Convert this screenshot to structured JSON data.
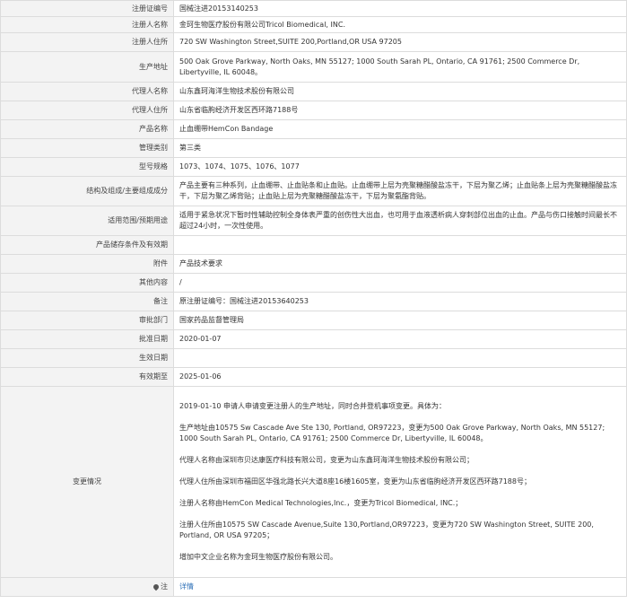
{
  "rows": [
    {
      "label": "注册证编号",
      "value": "国械注进20153140253"
    },
    {
      "label": "注册人名称",
      "value": "金珂生物医疗股份有限公司Tricol Biomedical, INC."
    },
    {
      "label": "注册人住所",
      "value": "720 SW Washington Street,SUITE 200,Portland,OR USA 97205"
    },
    {
      "label": "生产地址",
      "value": "500 Oak Grove Parkway, North Oaks, MN 55127; 1000 South Sarah PL, Ontario, CA 91761; 2500 Commerce Dr, Libertyville, IL 60048。"
    },
    {
      "label": "代理人名称",
      "value": "山东鑫珂海洋生物技术股份有限公司"
    },
    {
      "label": "代理人住所",
      "value": "山东省临朐经济开发区西环路7188号"
    },
    {
      "label": "产品名称",
      "value": "止血绷带HemCon Bandage"
    },
    {
      "label": "管理类别",
      "value": "第三类"
    },
    {
      "label": "型号规格",
      "value": "1073、1074、1075、1076、1077"
    },
    {
      "label": "结构及组成/主要组成成分",
      "value": "产品主要有三种系列，止血绷带、止血贴条和止血贴。止血绷带上层为壳聚糖醋酸盐冻干，下层为聚乙烯；止血贴条上层为壳聚糖醋酸盐冻干，下层为聚乙烯背贴；止血贴上层为壳聚糖醋酸盐冻干，下层为聚氨酯背贴。"
    },
    {
      "label": "适用范围/预期用途",
      "value": "适用于紧急状况下暂时性辅助控制全身体表严重的创伤性大出血，也可用于血液透析病人穿刺部位出血的止血。产品与伤口接触时间最长不超过24小时，一次性使用。"
    },
    {
      "label": "产品储存条件及有效期",
      "value": ""
    },
    {
      "label": "附件",
      "value": "产品技术要求"
    },
    {
      "label": "其他内容",
      "value": "/"
    },
    {
      "label": "备注",
      "value": "原注册证编号：国械注进20153640253"
    },
    {
      "label": "审批部门",
      "value": "国家药品监督管理局"
    },
    {
      "label": "批准日期",
      "value": "2020-01-07"
    },
    {
      "label": "生效日期",
      "value": ""
    },
    {
      "label": "有效期至",
      "value": "2025-01-06"
    }
  ],
  "changes": {
    "label": "变更情况",
    "paragraphs": [
      "2019-01-10 申请人申请变更注册人的生产地址，同时合并登机事项变更。具体为：",
      "生产地址由10575 Sw Cascade Ave Ste 130, Portland, OR97223，变更为500 Oak Grove Parkway, North Oaks, MN 55127; 1000 South Sarah PL, Ontario, CA 91761; 2500 Commerce Dr, Libertyville, IL 60048。",
      "代理人名称由深圳市贝达康医疗科技有限公司，变更为山东鑫珂海洋生物技术股份有限公司；",
      "代理人住所由深圳市福田区华强北路长兴大道8座16楼1605室，变更为山东省临朐经济开发区西环路7188号；",
      "注册人名称由HemCon Medical Technologies,Inc.，变更为Tricol Biomedical, INC.；",
      "注册人住所由10575 SW Cascade Avenue,Suite 130,Portland,OR97223，变更为720 SW Washington Street, SUITE 200, Portland, OR USA 97205；",
      "增加中文企业名称为金珂生物医疗股份有限公司。"
    ]
  },
  "footer": {
    "label": "注",
    "link": "详情"
  },
  "icons": {
    "footer_pin": "map-pin-icon"
  }
}
